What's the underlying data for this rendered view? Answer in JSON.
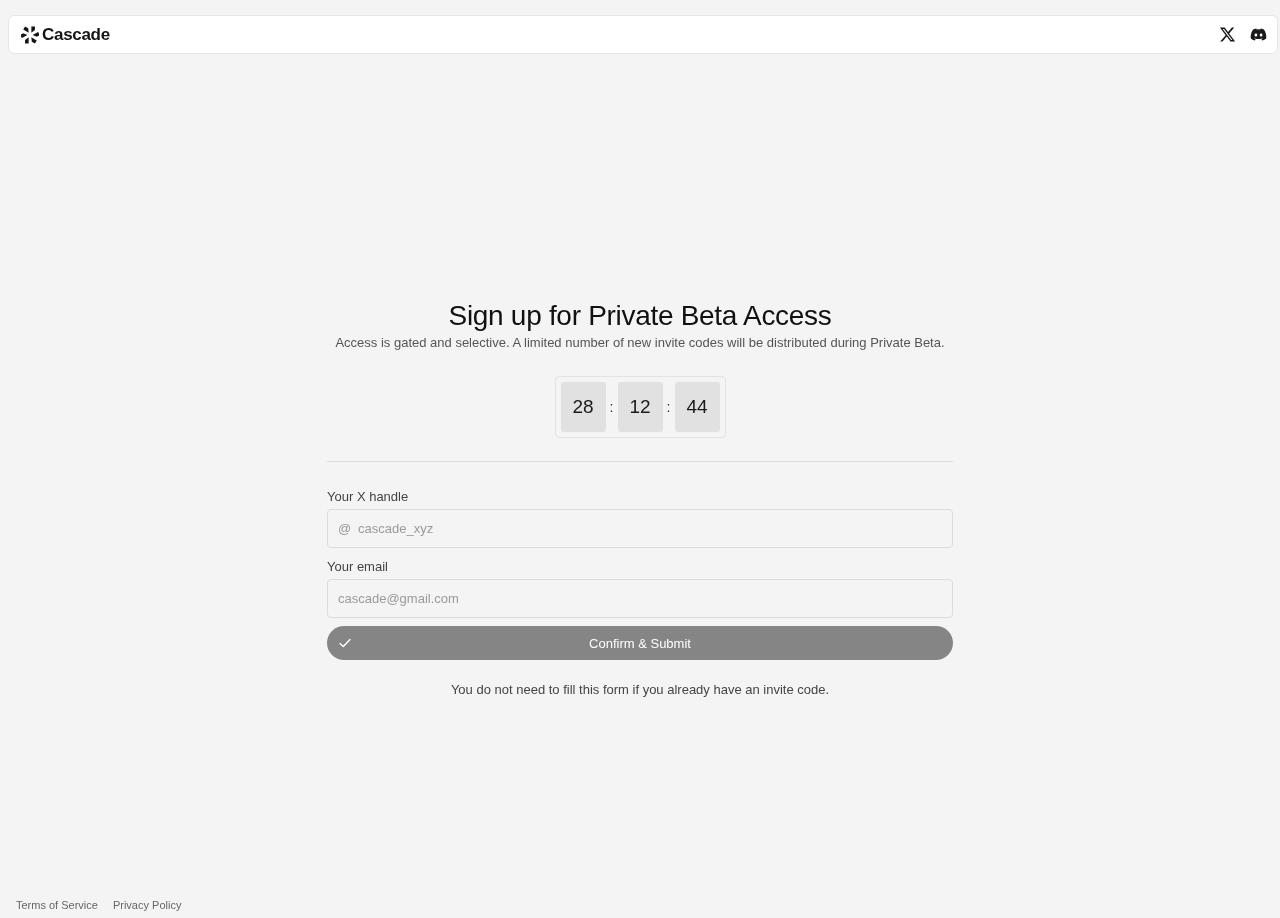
{
  "header": {
    "brand": "Cascade"
  },
  "title": "Sign up for Private Beta Access",
  "subtitle": "Access is gated and selective. A limited number of new invite codes will be distributed during Private Beta.",
  "countdown": [
    {
      "kind": "digits",
      "text": "28"
    },
    {
      "kind": "separator",
      "text": ":"
    },
    {
      "kind": "digits",
      "text": "12"
    },
    {
      "kind": "separator",
      "text": ":"
    },
    {
      "kind": "digits",
      "text": "44"
    }
  ],
  "form": {
    "fields": [
      {
        "label": "Your X handle",
        "prefix": "@",
        "placeholder": "cascade_xyz"
      },
      {
        "label": "Your email",
        "placeholder": "cascade@gmail.com"
      }
    ],
    "submit": {
      "label": "Confirm & Submit",
      "disabled": true
    },
    "note": "You do not need to fill this form if you already have an invite code."
  },
  "footer": {
    "links": [
      "Terms of Service",
      "Privacy Policy"
    ]
  }
}
